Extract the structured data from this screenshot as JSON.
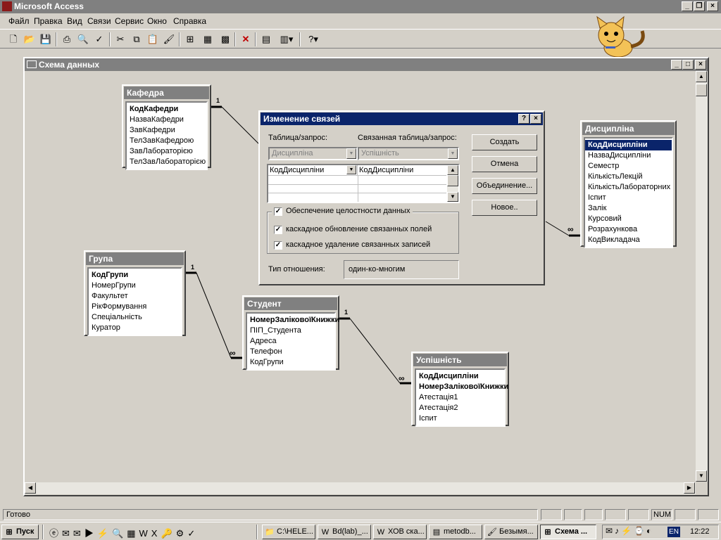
{
  "app": {
    "title": "Microsoft Access"
  },
  "menu": [
    "Файл",
    "Правка",
    "Вид",
    "Связи",
    "Сервис",
    "Окно",
    "Справка"
  ],
  "window": {
    "title": "Схема данных"
  },
  "tables": {
    "kafedra": {
      "title": "Кафедра",
      "fields": [
        "КодКафедри",
        "НазваКафедри",
        "ЗавКафедри",
        "ТелЗавКафедрою",
        "ЗавЛабораторією",
        "ТелЗавЛабораторією"
      ]
    },
    "dyscyplina": {
      "title": "Дисципліна",
      "fields": [
        "КодДисципліни",
        "НазваДисципліни",
        "Семестр",
        "КількістьЛекцій",
        "КількістьЛабораторних",
        "Іспит",
        "Залік",
        "Курсовий",
        "Розрахункова",
        "КодВикладача"
      ]
    },
    "grupa": {
      "title": "Група",
      "fields": [
        "КодГрупи",
        "НомерГрупи",
        "Факультет",
        "РікФормування",
        "Спеціальність",
        "Куратор"
      ]
    },
    "student": {
      "title": "Студент",
      "fields": [
        "НомерЗаліковоїКнижки",
        "ПІП_Студента",
        "Адреса",
        "Телефон",
        "КодГрупи"
      ]
    },
    "uspishnist": {
      "title": "Успішність",
      "fields": [
        "КодДисципліни",
        "НомерЗаліковоїКнижки",
        "Атестація1",
        "Атестація2",
        "Іспит"
      ]
    }
  },
  "relation_marks": {
    "one": "1",
    "many": "∞"
  },
  "dialog": {
    "title": "Изменение связей",
    "help": "?",
    "close": "×",
    "table_label": "Таблица/запрос:",
    "related_label": "Связанная таблица/запрос:",
    "table_value": "Дисципліна",
    "related_value": "Успішність",
    "field_left": "КодДисципліни",
    "field_right": "КодДисципліни",
    "integrity": "Обеспечение целостности данных",
    "cascade_update": "каскадное обновление связанных полей",
    "cascade_delete": "каскадное удаление связанных записей",
    "relation_type_label": "Тип отношения:",
    "relation_type_value": "один-ко-многим",
    "buttons": {
      "create": "Создать",
      "cancel": "Отмена",
      "join": "Объединение...",
      "new": "Новое.."
    }
  },
  "status": {
    "text": "Готово",
    "num": "NUM"
  },
  "taskbar": {
    "start": "Пуск",
    "tasks": [
      "C:\\HELE...",
      "Bd(lab)_...",
      "ХОВ ска...",
      "metodb...",
      "Безымя...",
      "Схема ..."
    ],
    "lang": "EN",
    "clock": "12:22"
  }
}
